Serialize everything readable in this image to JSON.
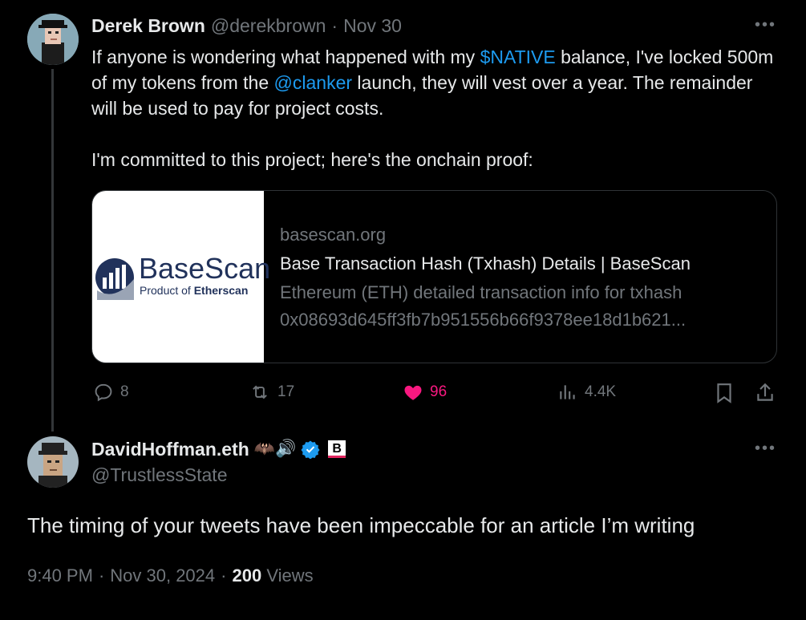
{
  "tweet": {
    "author_name": "Derek Brown",
    "author_handle": "@derekbrown",
    "separator": "·",
    "date": "Nov 30",
    "text_part1": "If anyone is wondering what happened with my ",
    "cashtag": "$NATIVE",
    "text_part2": " balance, I've locked 500m of my tokens from the ",
    "mention": "@clanker",
    "text_part3": " launch, they will vest over a year. The remainder will be used to pay for project costs.\n\nI'm committed to this project; here's the onchain proof:",
    "card": {
      "logo_text": "BaseScan",
      "logo_subtext_prefix": "Product of ",
      "logo_subtext_bold": "Etherscan",
      "domain": "basescan.org",
      "title": "Base Transaction Hash (Txhash) Details | BaseScan",
      "desc_line1": "Ethereum (ETH) detailed transaction info for txhash",
      "desc_line2": "0x08693d645ff3fb7b951556b66f9378ee18d1b621..."
    },
    "actions": {
      "replies": "8",
      "reposts": "17",
      "likes": "96",
      "views": "4.4K"
    },
    "colors": {
      "like": "#f91880",
      "link": "#1d9bf0"
    }
  },
  "reply": {
    "author_name": "DavidHoffman.eth",
    "emoji": "🦇🔊",
    "badge": "B",
    "author_handle": "@TrustlessState",
    "text": "The timing of your tweets have been impeccable for an article I’m writing",
    "time": "9:40 PM",
    "separator": "·",
    "date": "Nov 30, 2024",
    "separator2": "·",
    "views_count": "200",
    "views_label": "Views"
  }
}
